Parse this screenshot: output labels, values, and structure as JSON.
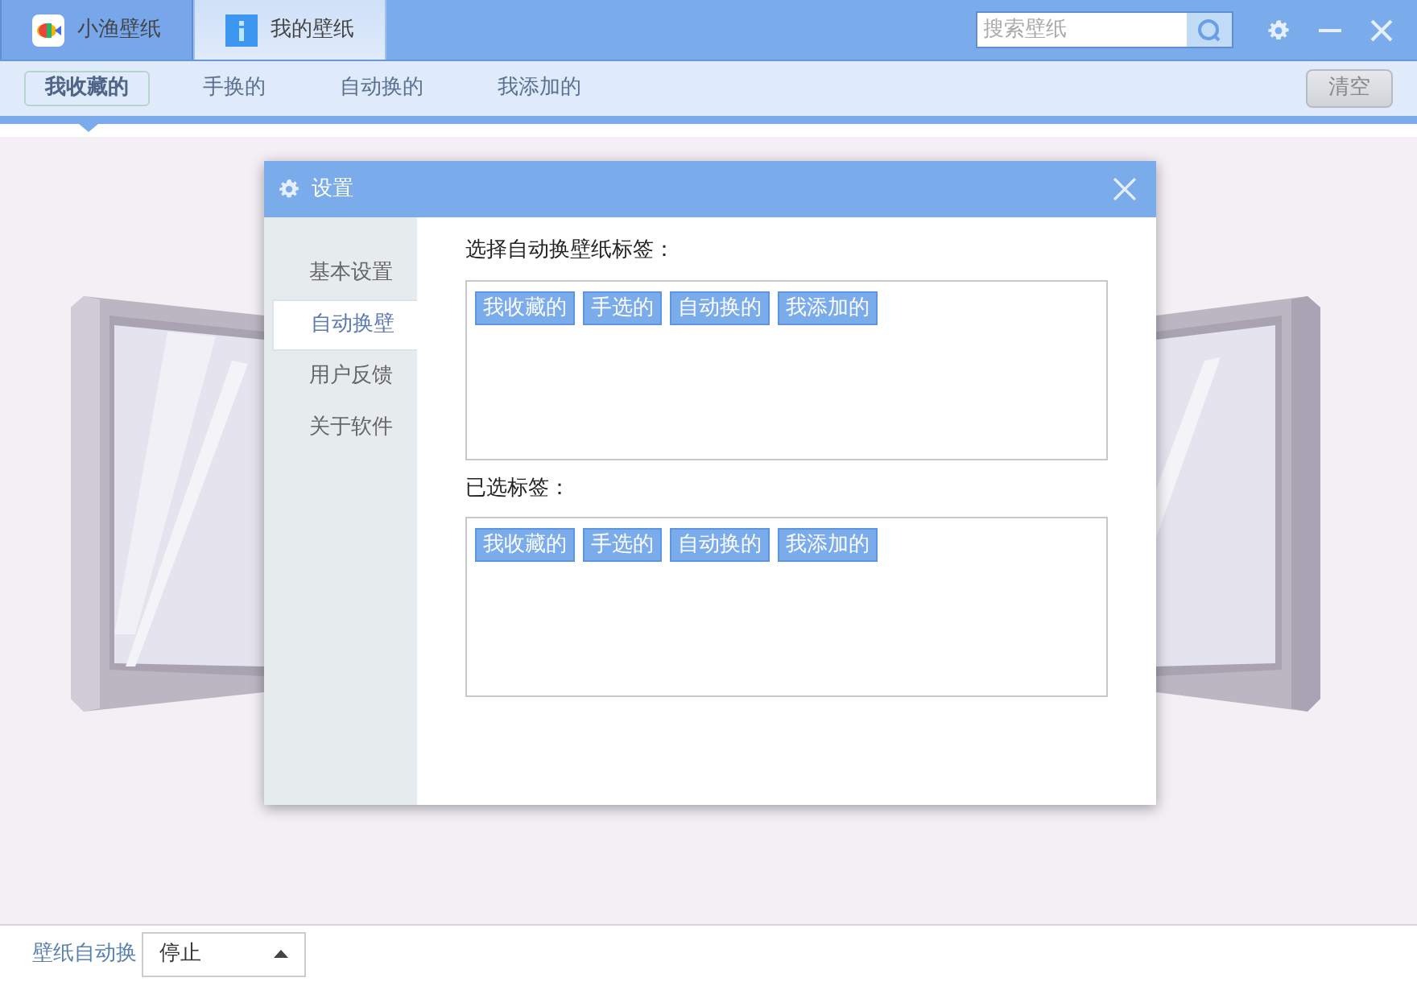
{
  "title_bar": {
    "tabs": [
      {
        "label": "小渔壁纸",
        "selected": false
      },
      {
        "label": "我的壁纸",
        "selected": true
      }
    ],
    "search": {
      "placeholder": "搜索壁纸"
    }
  },
  "category_tabs": [
    {
      "label": "我收藏的",
      "selected": true
    },
    {
      "label": "手换的",
      "selected": false
    },
    {
      "label": "自动换的",
      "selected": false
    },
    {
      "label": "我添加的",
      "selected": false
    }
  ],
  "clear_button": {
    "label": "清空",
    "disabled": true
  },
  "dialog": {
    "title": "设置",
    "sidebar": [
      {
        "label": "基本设置",
        "selected": false
      },
      {
        "label": "自动换壁",
        "selected": true
      },
      {
        "label": "用户反馈",
        "selected": false
      },
      {
        "label": "关于软件",
        "selected": false
      }
    ],
    "available_label": "选择自动换壁纸标签：",
    "available_tags": [
      "我收藏的",
      "手选的",
      "自动换的",
      "我添加的"
    ],
    "selected_label": "已选标签：",
    "selected_tags": [
      "我收藏的",
      "手选的",
      "自动换的",
      "我添加的"
    ]
  },
  "status_bar": {
    "label": "壁纸自动换",
    "select": {
      "value": "停止"
    }
  }
}
